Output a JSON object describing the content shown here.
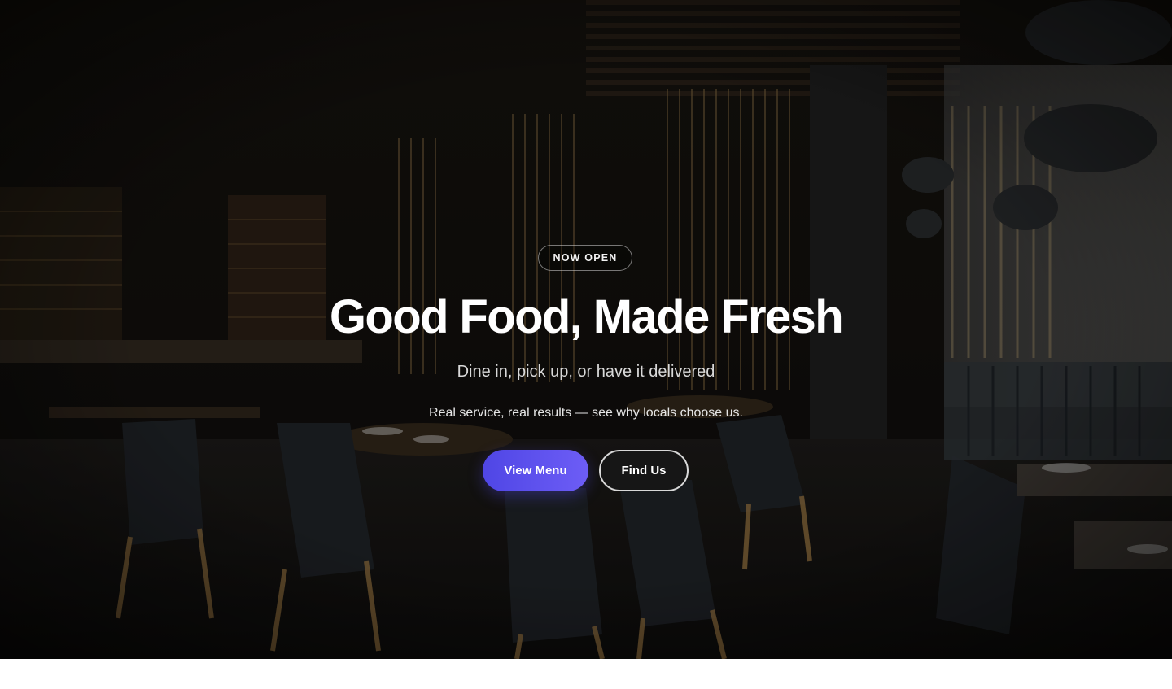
{
  "hero": {
    "badge": "NOW OPEN",
    "title": "Good Food, Made Fresh",
    "subtitle": "Dine in, pick up, or have it delivered",
    "tagline": "Real service, real results — see why locals choose us.",
    "primary_button": "View Menu",
    "secondary_button": "Find Us"
  },
  "colors": {
    "accent": "#5b50ee",
    "overlay": "#0b0a09",
    "text": "#ffffff"
  }
}
